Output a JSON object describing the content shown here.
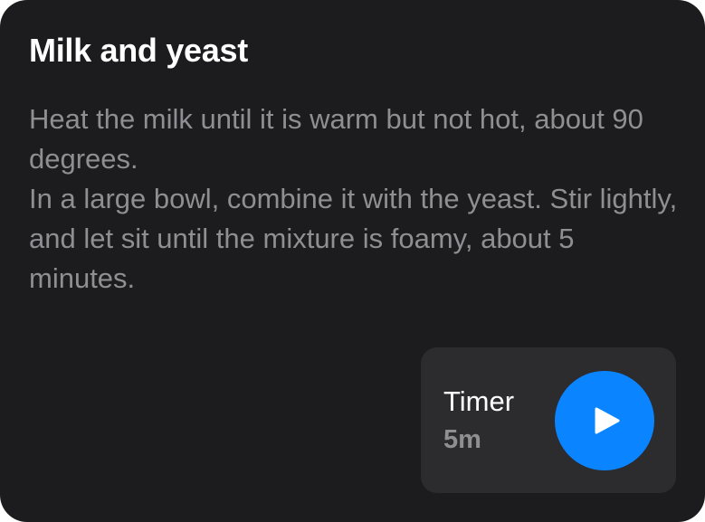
{
  "card": {
    "title": "Milk and yeast",
    "instructions": [
      "Heat the milk until it is warm but not hot, about 90 degrees.",
      "In a large bowl, combine it with the yeast. Stir lightly, and let sit until the mixture is foamy, about 5 minutes."
    ]
  },
  "timer": {
    "label": "Timer",
    "duration": "5m",
    "play_icon": "play-icon"
  },
  "colors": {
    "card_background": "#1c1c1e",
    "panel_background": "#2c2c2e",
    "title_text": "#ffffff",
    "secondary_text": "#8e8e93",
    "accent": "#0a84ff"
  }
}
